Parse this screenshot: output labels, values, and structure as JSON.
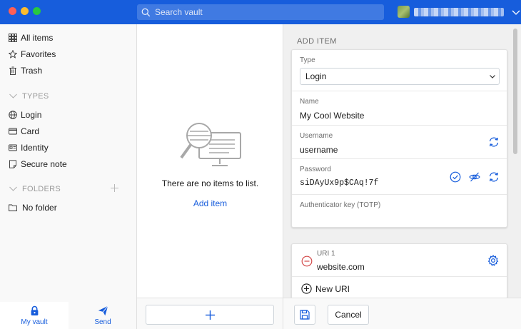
{
  "titlebar": {
    "search_placeholder": "Search vault",
    "search_icon": "search-icon",
    "account_icon": "avatar",
    "chevron_icon": "chevron-down-icon"
  },
  "sidebar": {
    "items": [
      {
        "label": "All items",
        "icon": "grid-icon"
      },
      {
        "label": "Favorites",
        "icon": "star-icon"
      },
      {
        "label": "Trash",
        "icon": "trash-icon"
      }
    ],
    "types_heading": "TYPES",
    "types": [
      {
        "label": "Login",
        "icon": "globe-icon"
      },
      {
        "label": "Card",
        "icon": "card-icon"
      },
      {
        "label": "Identity",
        "icon": "id-card-icon"
      },
      {
        "label": "Secure note",
        "icon": "note-icon"
      }
    ],
    "folders_heading": "FOLDERS",
    "folders": [
      {
        "label": "No folder",
        "icon": "folder-icon"
      }
    ],
    "tabs": [
      {
        "label": "My vault",
        "icon": "lock-icon"
      },
      {
        "label": "Send",
        "icon": "send-icon"
      }
    ]
  },
  "list": {
    "empty_text": "There are no items to list.",
    "add_item_link": "Add item"
  },
  "detail": {
    "heading": "ADD ITEM",
    "type_label": "Type",
    "type_value": "Login",
    "name_label": "Name",
    "name_value": "My Cool Website",
    "username_label": "Username",
    "username_value": "username",
    "password_label": "Password",
    "password_value": "siDAyUx9p$CAq!7f",
    "totp_label": "Authenticator key (TOTP)",
    "uri_label": "URI 1",
    "uri_value": "website.com",
    "new_uri_label": "New URI",
    "cancel_label": "Cancel"
  },
  "colors": {
    "brand": "#175ddc",
    "danger": "#d34a4a",
    "background": "#f0f0f0"
  }
}
